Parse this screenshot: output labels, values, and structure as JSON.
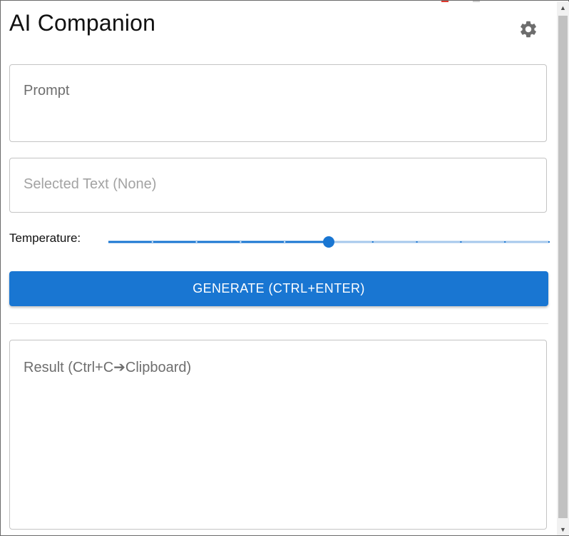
{
  "app": {
    "title": "AI Companion"
  },
  "fields": {
    "prompt_placeholder": "Prompt",
    "selected_placeholder": "Selected Text (None)",
    "result_placeholder": "Result (Ctrl+C➔Clipboard)"
  },
  "temperature": {
    "label": "Temperature:",
    "value_fraction": 0.5,
    "steps": 10
  },
  "actions": {
    "generate_label": "GENERATE (CTRL+ENTER)"
  },
  "icons": {
    "settings": "gear-icon",
    "scroll_up": "arrow-up-icon",
    "scroll_down": "arrow-down-icon"
  },
  "colors": {
    "accent": "#1976d2",
    "accent_light": "#a6c8ec"
  }
}
